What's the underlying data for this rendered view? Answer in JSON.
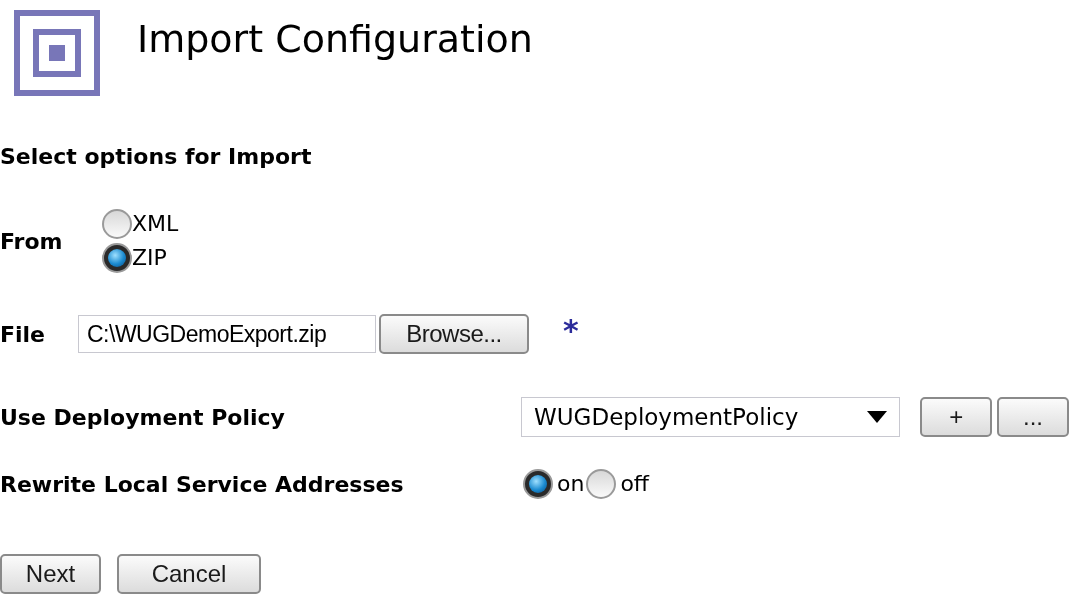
{
  "title": "Import Configuration",
  "section_heading": "Select options for Import",
  "from": {
    "label": "From",
    "options": [
      {
        "label": "XML",
        "selected": false
      },
      {
        "label": "ZIP",
        "selected": true
      }
    ]
  },
  "file": {
    "label": "File",
    "value": "C:\\WUGDemoExport.zip",
    "browse_button": "Browse...",
    "required_mark": "*"
  },
  "deployment_policy": {
    "label": "Use Deployment Policy",
    "value": "WUGDeploymentPolicy",
    "add_button": "+",
    "more_button": "..."
  },
  "rewrite_addresses": {
    "label": "Rewrite Local Service Addresses",
    "options": [
      {
        "label": "on",
        "selected": true
      },
      {
        "label": "off",
        "selected": false
      }
    ]
  },
  "buttons": [
    "Next",
    "Cancel"
  ]
}
